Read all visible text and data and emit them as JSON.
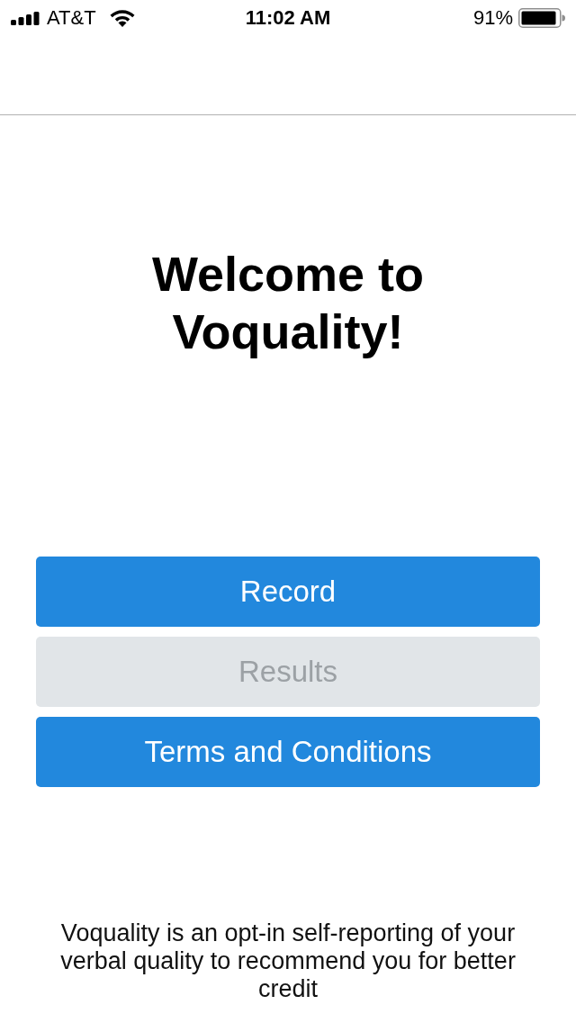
{
  "status_bar": {
    "carrier": "AT&T",
    "time": "11:02 AM",
    "battery_percent": "91%"
  },
  "title": "Welcome to Voquality!",
  "buttons": [
    {
      "label": "Record",
      "disabled": false
    },
    {
      "label": "Results",
      "disabled": true
    },
    {
      "label": "Terms and Conditions",
      "disabled": false
    }
  ],
  "footer_text": "Voquality is an opt-in self-reporting of your verbal quality to recommend you for better credit"
}
